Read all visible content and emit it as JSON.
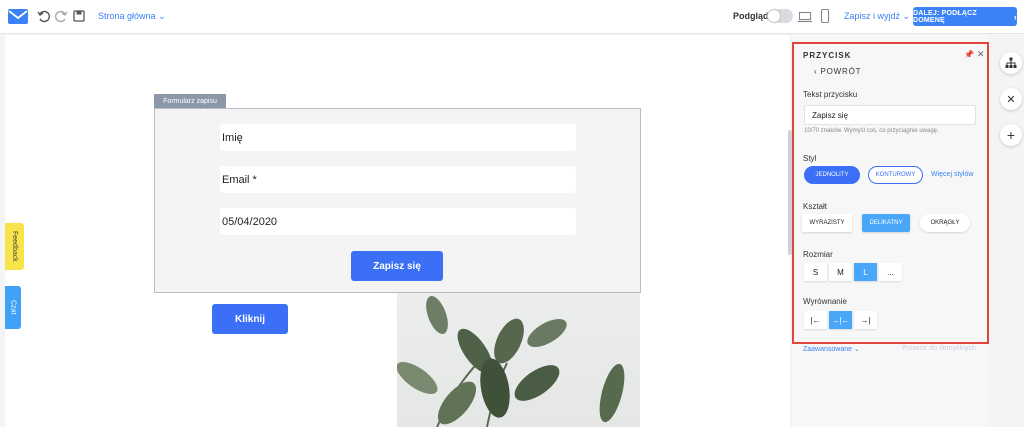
{
  "topbar": {
    "page_selector": "Strona główna",
    "preview_label": "Podgląd",
    "save_exit": "Zapisz i wyjdź",
    "next_button": "DALEJ: PODŁĄCZ DOMENĘ",
    "next_arrow": "›"
  },
  "canvas": {
    "feedback_tab": "Feedback",
    "chat_tab": "Czat",
    "form_tag": "Formularz zapisu",
    "fields": [
      "Imię",
      "Email *",
      "05/04/2020"
    ],
    "submit_label": "Zapisz się",
    "click_button": "Kliknij"
  },
  "panel": {
    "title": "PRZYCISK",
    "back": "POWRÓT",
    "text_label": "Tekst przycisku",
    "text_value": "Zapisz się",
    "text_hint": "10/70 znaków. Wymyśl coś, co przyciągnie uwagę.",
    "style_label": "Styl",
    "style_options": [
      "JEDNOLITY",
      "KONTUROWY"
    ],
    "more_styles": "Więcej stylów",
    "shape_label": "Kształt",
    "shape_options": [
      "WYRAZISTY",
      "DELIKATNY",
      "OKRĄGŁY"
    ],
    "size_label": "Rozmiar",
    "size_options": [
      "S",
      "M",
      "L",
      "..."
    ],
    "align_label": "Wyrównanie",
    "align_options": [
      "|←",
      "→|←",
      "→|"
    ],
    "advanced": "Zaawansowane ⌄",
    "reset": "Przwróć do domyślnych"
  },
  "colors": {
    "accent": "#3b6ff6",
    "highlight_border": "#e0463c",
    "active_segment": "#4aa6f8"
  }
}
